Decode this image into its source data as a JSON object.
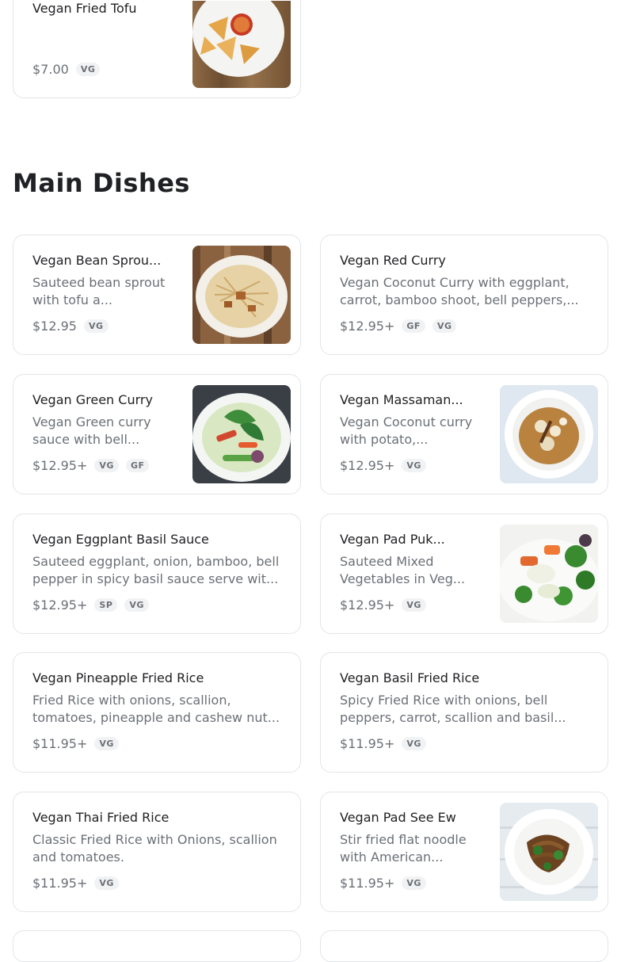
{
  "section": {
    "title": "Main Dishes"
  },
  "previous_section_items": [
    {
      "name": "Vegan Fried Tofu",
      "price": "$7.00",
      "tags": [
        "VG"
      ]
    }
  ],
  "items": [
    {
      "name": "Vegan Bean Sprou...",
      "description": "Sauteed bean sprout with tofu a...",
      "price": "$12.95",
      "tags": [
        "VG"
      ]
    },
    {
      "name": "Vegan Red Curry",
      "description": "Vegan Coconut Curry with eggplant, carrot, bamboo shoot, bell peppers,...",
      "price": "$12.95+",
      "tags": [
        "GF",
        "VG"
      ]
    },
    {
      "name": "Vegan Green Curry",
      "description": "Vegan Green curry sauce with bell...",
      "price": "$12.95+",
      "tags": [
        "VG",
        "GF"
      ]
    },
    {
      "name": "Vegan Massaman...",
      "description": "Vegan Coconut curry with potato,...",
      "price": "$12.95+",
      "tags": [
        "VG"
      ]
    },
    {
      "name": "Vegan Eggplant Basil Sauce",
      "description": "Sauteed eggplant, onion, bamboo, bell pepper in spicy basil sauce serve wit...",
      "price": "$12.95+",
      "tags": [
        "SP",
        "VG"
      ]
    },
    {
      "name": "Vegan Pad Puk...",
      "description": "Sauteed Mixed Vegetables in Veg...",
      "price": "$12.95+",
      "tags": [
        "VG"
      ]
    },
    {
      "name": "Vegan Pineapple Fried Rice",
      "description": "Fried Rice with onions, scallion, tomatoes, pineapple and cashew nut...",
      "price": "$11.95+",
      "tags": [
        "VG"
      ]
    },
    {
      "name": "Vegan Basil Fried Rice",
      "description": "Spicy Fried Rice with onions, bell peppers, carrot, scallion and basil...",
      "price": "$11.95+",
      "tags": [
        "VG"
      ]
    },
    {
      "name": "Vegan Thai Fried Rice",
      "description": "Classic Fried Rice with Onions, scallion and tomatoes.",
      "price": "$11.95+",
      "tags": [
        "VG"
      ]
    },
    {
      "name": "Vegan Pad See Ew",
      "description": "Stir fried flat noodle with American...",
      "price": "$11.95+",
      "tags": [
        "VG"
      ]
    }
  ]
}
